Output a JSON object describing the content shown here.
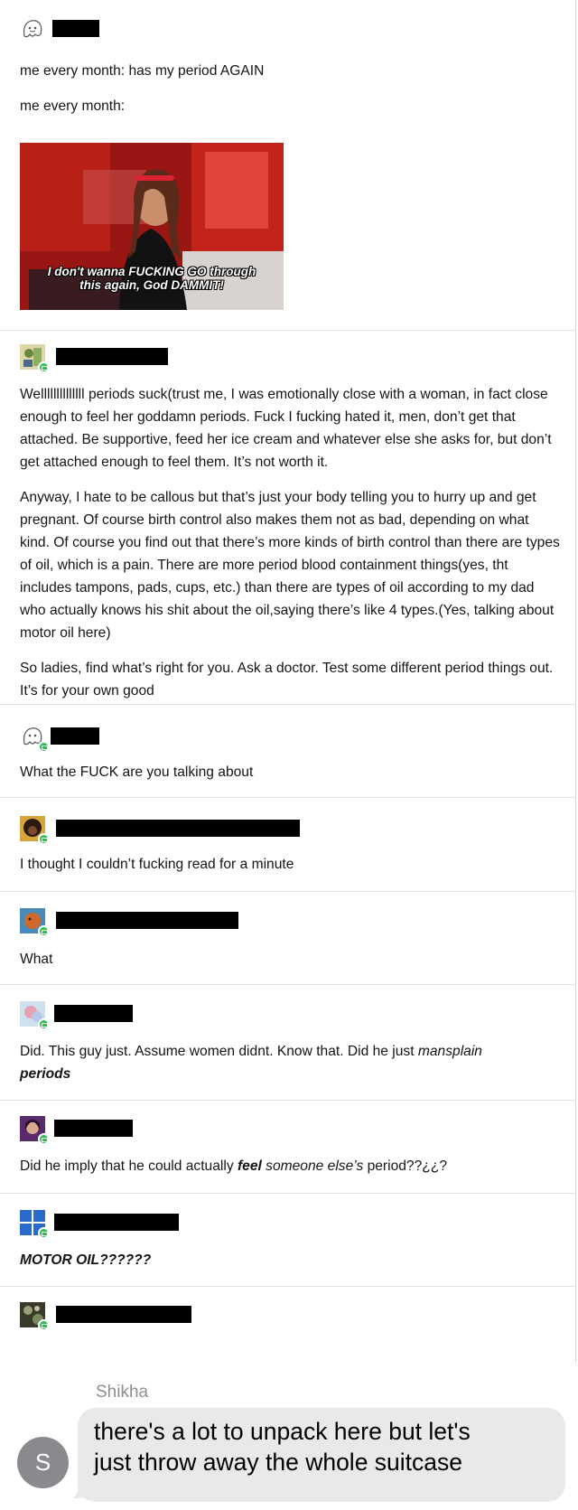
{
  "posts": [
    {
      "paragraphs": [
        "me every month: has my period AGAIN",
        "me every month:"
      ],
      "gif_caption": [
        "I don't wanna FUCKING GO through",
        "this again, God DAMMIT!"
      ]
    },
    {
      "paragraphs": [
        "Wellllllllllllll periods suck(trust me, I was emotionally close with a woman, in fact close enough to feel her goddamn periods. Fuck I fucking hated it, men, don’t get that attached. Be supportive, feed her ice cream and whatever else she asks for, but don’t get attached enough to feel them. It’s not worth it.",
        "Anyway, I hate to be callous but that’s just your body telling you to hurry up and get pregnant. Of course birth control also makes them not as bad, depending on what kind. Of course you find out that there’s more kinds of birth control than there are types of oil, which is a pain. There are more period blood containment things(yes, tht includes tampons, pads, cups, etc.) than there are types of oil according to my dad who actually knows his shit about the oil,saying there’s like 4 types.(Yes, talking about motor oil here)",
        "So ladies, find what’s right for you. Ask a doctor. Test some different period things out. It’s for your own good"
      ]
    },
    {
      "text": "What the FUCK are you talking about"
    },
    {
      "text": "I thought I couldn’t fucking read for a minute"
    },
    {
      "text": "What"
    },
    {
      "text_before": "Did. This guy just. Assume women didnt. Know that. Did he just ",
      "text_italic": "mansplain",
      "text_bold_italic": "periods"
    },
    {
      "text_before": "Did he imply that he could actually ",
      "text_bold_italic": "feel",
      "text_italic": " someone else’s",
      "text_after": " period??¿¿?"
    },
    {
      "text_bold_italic": "MOTOR OIL??????"
    },
    {}
  ],
  "chat": {
    "sender": "Shikha",
    "avatar_letter": "S",
    "message_line1": "there's a lot to unpack here but let's",
    "message_line2": "just throw away the whole suitcase"
  },
  "colors": {
    "reblog_badge": "#2fbf4f",
    "bubble": "#e9e9eb",
    "chat_avatar": "#8a8a8e",
    "gif_background": "#8e1410"
  },
  "icons": [
    "ghost-avatar-icon",
    "anime-avatar-icon",
    "reblog-badge-icon"
  ]
}
